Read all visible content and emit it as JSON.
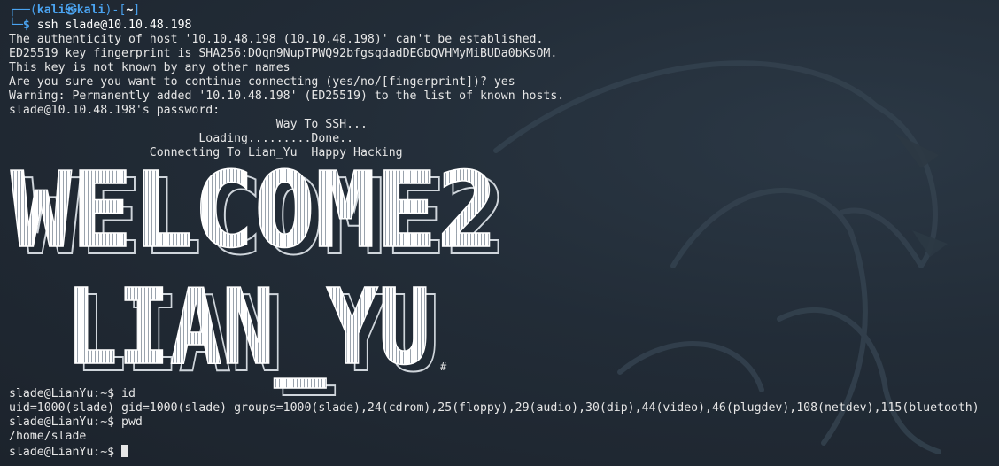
{
  "prompt_top": {
    "user": "kali",
    "at_symbol": "㉿",
    "host": "kali",
    "cwd": "~",
    "dollar": "$",
    "command": "ssh slade@10.10.48.198"
  },
  "output": [
    "The authenticity of host '10.10.48.198 (10.10.48.198)' can't be established.",
    "ED25519 key fingerprint is SHA256:DOqn9NupTPWQ92bfgsqdadDEGbQVHMyMiBUDa0bKsOM.",
    "This key is not known by any other names",
    "Are you sure you want to continue connecting (yes/no/[fingerprint])? yes",
    "Warning: Permanently added '10.10.48.198' (ED25519) to the list of known hosts.",
    "slade@10.10.48.198's password:"
  ],
  "motd": [
    "                                      Way To SSH...",
    "                           Loading.........Done..",
    "                    Connecting To Lian_Yu  Happy Hacking"
  ],
  "banner": {
    "line1": "WELCOME2",
    "line2": "LIAN_YU",
    "hash": "#"
  },
  "session": [
    "slade@LianYu:~$ id",
    "uid=1000(slade) gid=1000(slade) groups=1000(slade),24(cdrom),25(floppy),29(audio),30(dip),44(video),46(plugdev),108(netdev),115(bluetooth)",
    "slade@LianYu:~$ pwd",
    "/home/slade"
  ],
  "final_prompt": "slade@LianYu:~$ ",
  "colors": {
    "background": "#1f2731",
    "prompt_blue": "#4aa3f0",
    "text": "#e6e6e6"
  }
}
